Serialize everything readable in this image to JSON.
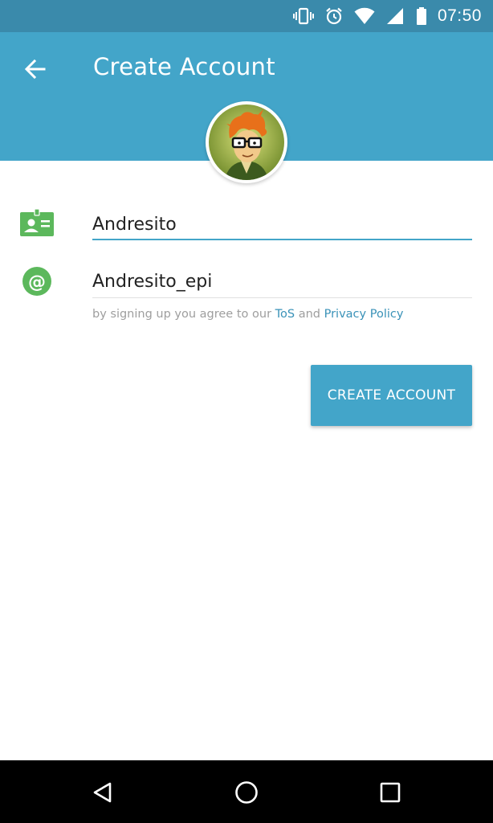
{
  "status_bar": {
    "time": "07:50",
    "icons": [
      "vibrate-icon",
      "alarm-icon",
      "wifi-icon",
      "signal-icon",
      "battery-icon"
    ]
  },
  "toolbar": {
    "title": "Create Account",
    "back_icon": "arrow-left-icon",
    "color": "#43a5c9"
  },
  "form": {
    "name_field": {
      "value": "Andresito",
      "icon": "id-card-icon"
    },
    "username_field": {
      "value": "Andresito_epi",
      "icon": "at-sign-icon"
    },
    "terms": {
      "prefix": "by signing up you agree to our",
      "tos_link": "ToS",
      "and": "and",
      "privacy_link": "Privacy Policy"
    },
    "create_button": "CREATE ACCOUNT"
  },
  "colors": {
    "primary": "#43a5c9",
    "status_bar": "#3a8aab",
    "icon_green": "#5cb85c",
    "link": "#3a92b8"
  },
  "nav_bar": {
    "icons": [
      "back-triangle-icon",
      "home-circle-icon",
      "recents-square-icon"
    ]
  }
}
